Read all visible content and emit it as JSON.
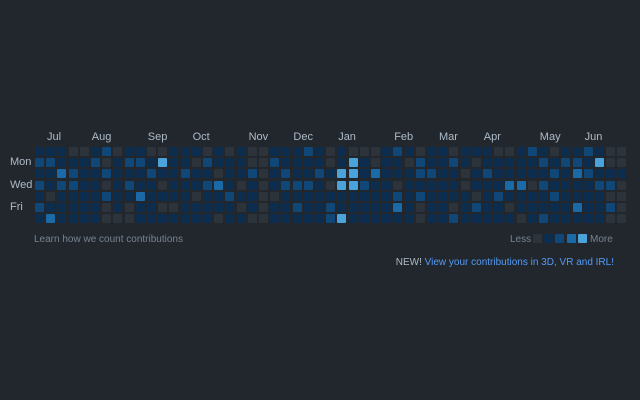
{
  "months": [
    "Jul",
    "Aug",
    "Sep",
    "Oct",
    "Nov",
    "Dec",
    "Jan",
    "Feb",
    "Mar",
    "Apr",
    "May",
    "Jun"
  ],
  "month_week_index": [
    0,
    4,
    9,
    13,
    18,
    22,
    26,
    31,
    35,
    39,
    44,
    48
  ],
  "day_labels": [
    {
      "label": "Mon",
      "row": 1
    },
    {
      "label": "Wed",
      "row": 3
    },
    {
      "label": "Fri",
      "row": 5
    }
  ],
  "colors": {
    "level0": "#2d333b",
    "level1": "#0d2d4e",
    "level2": "#0e4778",
    "level3": "#1b6aa8",
    "level4": "#4ba3dc"
  },
  "weeks": 53,
  "levels": [
    [
      1,
      1,
      1,
      0,
      0,
      1,
      2,
      0,
      1,
      1,
      0,
      0,
      1,
      1,
      1,
      0,
      1,
      0,
      1,
      0,
      0,
      1,
      1,
      1,
      2,
      1,
      0,
      1,
      0,
      0,
      0,
      1,
      2,
      1,
      0,
      1,
      1,
      0,
      1,
      1,
      1,
      0,
      0,
      1,
      2,
      1,
      0,
      1,
      1,
      2,
      1,
      0,
      0
    ],
    [
      2,
      2,
      1,
      1,
      1,
      2,
      0,
      1,
      2,
      2,
      1,
      4,
      1,
      1,
      0,
      2,
      1,
      1,
      1,
      0,
      0,
      2,
      1,
      1,
      1,
      1,
      0,
      1,
      4,
      1,
      0,
      1,
      1,
      0,
      2,
      1,
      1,
      2,
      1,
      0,
      1,
      1,
      1,
      1,
      1,
      2,
      1,
      2,
      2,
      1,
      4,
      0,
      0
    ],
    [
      1,
      1,
      3,
      2,
      1,
      1,
      2,
      1,
      1,
      1,
      2,
      1,
      1,
      2,
      1,
      1,
      0,
      1,
      1,
      2,
      0,
      1,
      2,
      1,
      1,
      2,
      1,
      4,
      4,
      1,
      3,
      1,
      1,
      1,
      2,
      2,
      1,
      1,
      0,
      1,
      2,
      1,
      1,
      1,
      1,
      1,
      2,
      1,
      3,
      2,
      1,
      1,
      1
    ],
    [
      2,
      1,
      2,
      2,
      1,
      1,
      0,
      1,
      2,
      1,
      1,
      0,
      1,
      1,
      1,
      2,
      3,
      1,
      0,
      1,
      0,
      1,
      2,
      2,
      2,
      1,
      0,
      4,
      4,
      2,
      1,
      1,
      0,
      1,
      1,
      1,
      1,
      1,
      0,
      1,
      1,
      1,
      3,
      3,
      0,
      2,
      1,
      1,
      1,
      1,
      2,
      2,
      0
    ],
    [
      1,
      0,
      1,
      1,
      1,
      1,
      2,
      1,
      1,
      3,
      1,
      1,
      1,
      1,
      0,
      1,
      1,
      2,
      1,
      1,
      0,
      0,
      1,
      1,
      1,
      1,
      1,
      1,
      1,
      1,
      1,
      1,
      2,
      1,
      2,
      1,
      1,
      1,
      1,
      0,
      1,
      2,
      1,
      1,
      1,
      1,
      2,
      1,
      1,
      1,
      1,
      0,
      0
    ],
    [
      2,
      1,
      1,
      1,
      1,
      1,
      0,
      1,
      0,
      1,
      1,
      0,
      0,
      1,
      1,
      1,
      1,
      1,
      0,
      1,
      0,
      1,
      1,
      2,
      1,
      1,
      2,
      1,
      1,
      1,
      1,
      1,
      3,
      1,
      0,
      1,
      1,
      0,
      1,
      2,
      1,
      1,
      0,
      1,
      1,
      1,
      1,
      1,
      3,
      1,
      1,
      2,
      0
    ],
    [
      1,
      3,
      1,
      1,
      1,
      1,
      0,
      0,
      0,
      1,
      1,
      1,
      1,
      1,
      1,
      1,
      0,
      1,
      1,
      0,
      0,
      1,
      1,
      1,
      1,
      1,
      2,
      4,
      1,
      1,
      1,
      1,
      1,
      1,
      0,
      1,
      1,
      2,
      1,
      1,
      1,
      1,
      1,
      0,
      1,
      2,
      1,
      1,
      1,
      1,
      1,
      0,
      0
    ]
  ],
  "footer": {
    "learn_link": "Learn how we count contributions",
    "less": "Less",
    "more": "More"
  },
  "promo": {
    "new_label": "NEW!",
    "link_text": "View your contributions in 3D, VR and IRL!"
  }
}
